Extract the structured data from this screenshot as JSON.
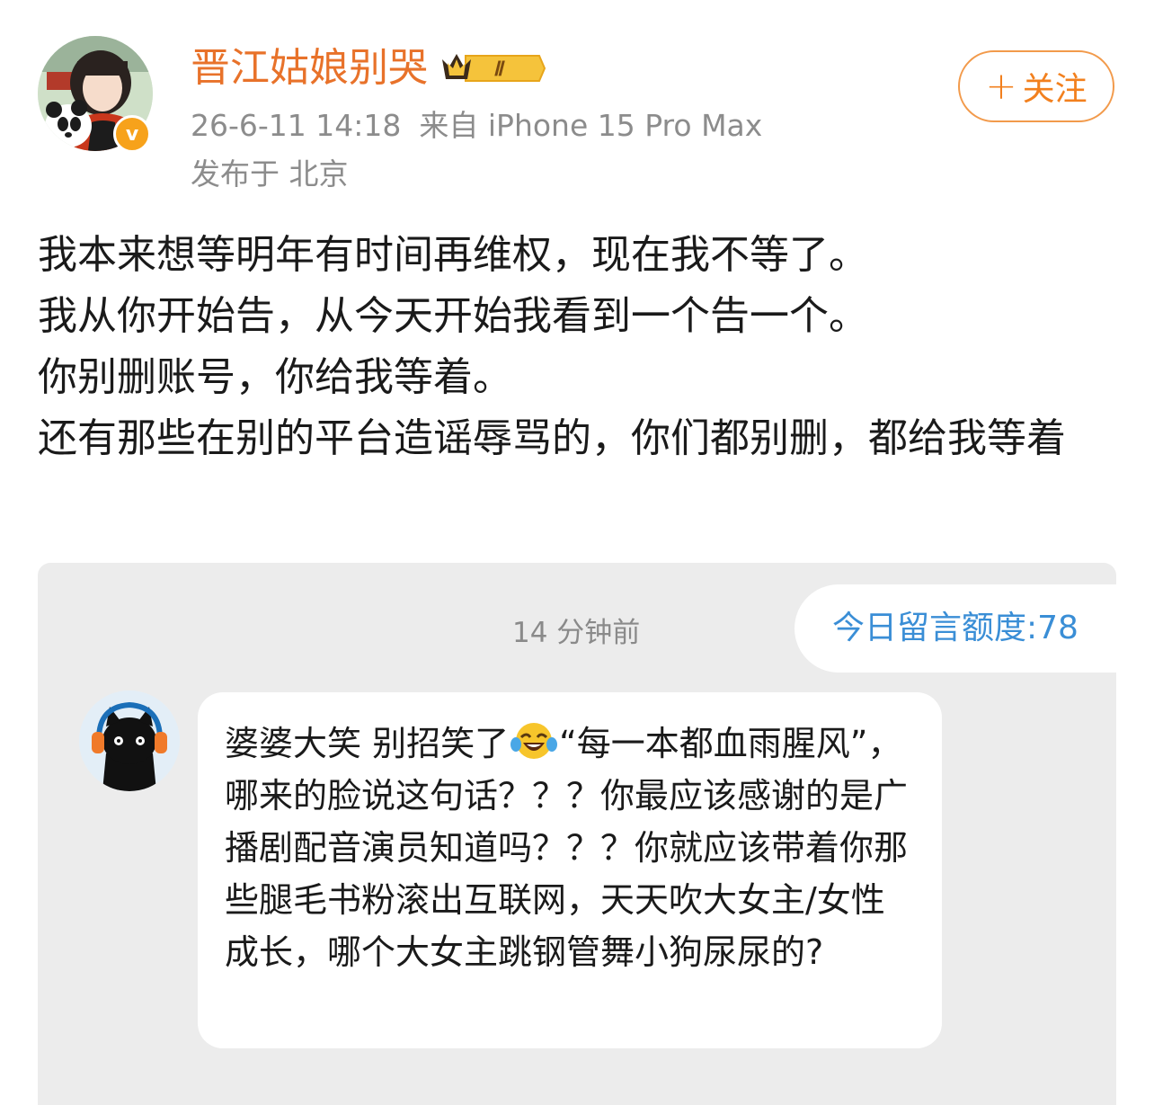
{
  "author": {
    "name": "晋江姑娘别哭",
    "level_badge": "Ⅱ",
    "verified_icon": "v",
    "accent_color": "#e8722a"
  },
  "meta": {
    "timestamp": "26-6-11 14:18",
    "source": "来自 iPhone 15 Pro Max",
    "location": "发布于 北京"
  },
  "follow_button": {
    "plus": "+",
    "label": "关注"
  },
  "post": {
    "lines": [
      "我本来想等明年有时间再维权，现在我不等了。",
      "我从你开始告，从今天开始我看到一个告一个。",
      "你别删账号，你给我等着。",
      "还有那些在别的平台造谣辱骂的，你们都别删，都给我等着"
    ]
  },
  "screenshot": {
    "time_ago": "14 分钟前",
    "quota": "今日留言额度:78",
    "comment": {
      "before_emoji": "婆婆大笑 别招笑了",
      "emoji_icon": "laughing-tears-emoji",
      "after_emoji": "“每一本都血雨腥风”，哪来的脸说这句话？？？你最应该感谢的是广播剧配音演员知道吗？？？你就应该带着你那些腿毛书粉滚出互联网，天天吹大女主/女性成长，哪个大女主跳钢管舞小狗尿尿的?"
    }
  }
}
